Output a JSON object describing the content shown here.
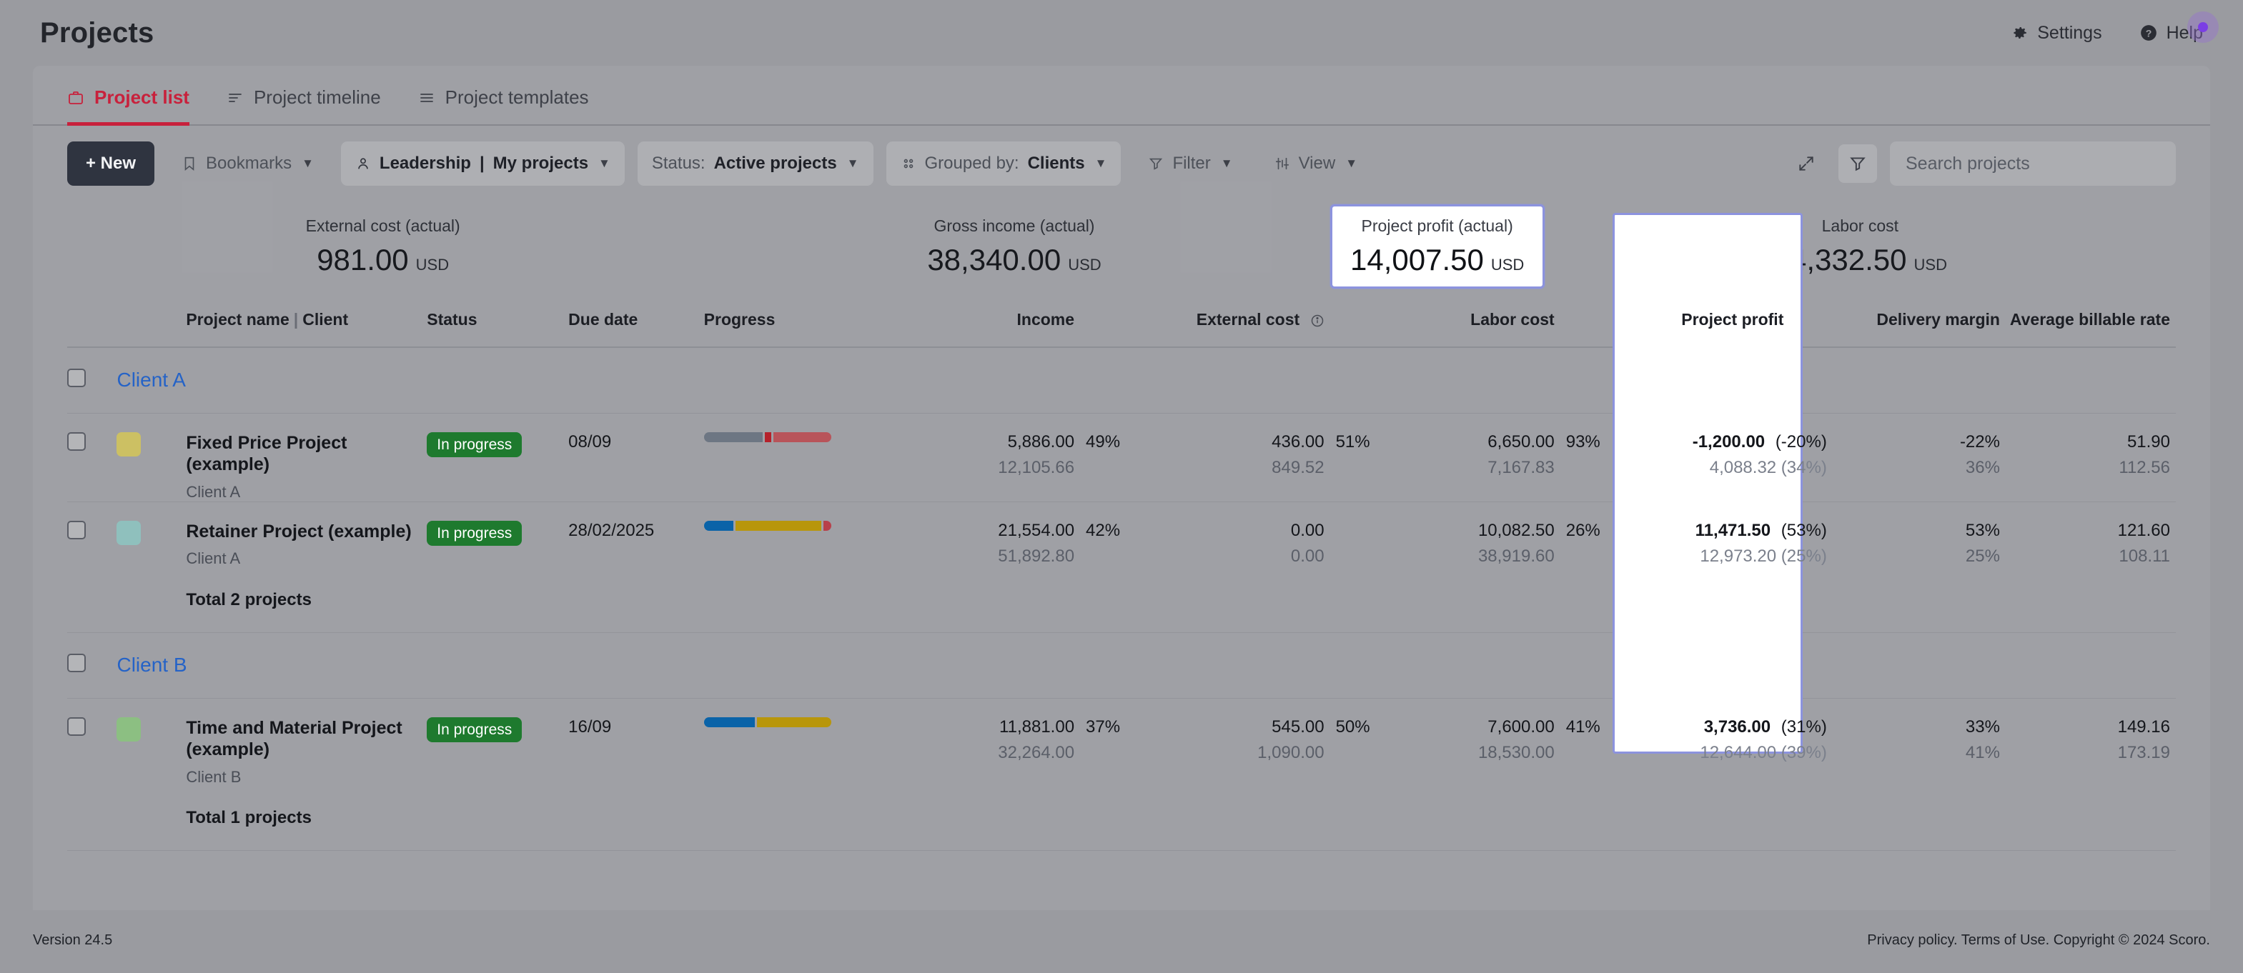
{
  "header": {
    "title": "Projects",
    "settings_label": "Settings",
    "help_label": "Help"
  },
  "tabs": [
    {
      "label": "Project list",
      "icon": "briefcase-icon",
      "active": true
    },
    {
      "label": "Project timeline",
      "icon": "timeline-icon",
      "active": false
    },
    {
      "label": "Project templates",
      "icon": "list-icon",
      "active": false
    }
  ],
  "toolbar": {
    "new_label": "+ New",
    "bookmarks_label": "Bookmarks",
    "view_scope_prefix": "Leadership",
    "view_scope_value": "My projects",
    "status_prefix": "Status:",
    "status_value": "Active projects",
    "grouped_prefix": "Grouped by:",
    "grouped_value": "Clients",
    "filter_label": "Filter",
    "view_label": "View",
    "search_placeholder": "Search projects"
  },
  "kpis": [
    {
      "label": "External cost (actual)",
      "value": "981.00",
      "currency": "USD",
      "highlight": false
    },
    {
      "label": "Gross income (actual)",
      "value": "38,340.00",
      "currency": "USD",
      "highlight": false
    },
    {
      "label": "Project profit (actual)",
      "value": "14,007.50",
      "currency": "USD",
      "highlight": true
    },
    {
      "label": "Labor cost",
      "value": "24,332.50",
      "currency": "USD",
      "highlight": false
    }
  ],
  "table": {
    "headers": {
      "project_name": "Project name",
      "client": "Client",
      "status": "Status",
      "due_date": "Due date",
      "progress": "Progress",
      "income": "Income",
      "external_cost": "External cost",
      "external_cost_info": "info-icon",
      "labor_cost": "Labor cost",
      "project_profit": "Project profit",
      "delivery_margin": "Delivery margin",
      "average_billable_rate": "Average billable rate"
    },
    "groups": [
      {
        "name": "Client A",
        "total_label": "Total 2 projects",
        "rows": [
          {
            "swatch_color": "#ccc063",
            "name": "Fixed Price Project (example)",
            "client": "Client A",
            "status": "In progress",
            "due_date": "08/09",
            "progress": [
              {
                "color": "#6d7683",
                "width": 48
              },
              {
                "color": "#b5212b",
                "width": 5
              },
              {
                "color": "#b8545a",
                "width": 47
              }
            ],
            "income": "5,886.00",
            "income_sub": "12,105.66",
            "income_pct": "49%",
            "external_cost": "436.00",
            "external_cost_sub": "849.52",
            "external_cost_pct": "51%",
            "labor_cost": "6,650.00",
            "labor_cost_sub": "7,167.83",
            "labor_cost_pct": "93%",
            "project_profit": "-1,200.00",
            "project_profit_pct": "(-20%)",
            "project_profit_sub": "4,088.32 (34%)",
            "delivery_margin": "-22%",
            "delivery_margin_sub": "36%",
            "avg_billable_rate": "51.90",
            "avg_billable_rate_sub": "112.56"
          },
          {
            "swatch_color": "#8fc0bd",
            "name": "Retainer Project (example)",
            "client": "Client A",
            "status": "In progress",
            "due_date": "28/02/2025",
            "progress": [
              {
                "color": "#0a63a8",
                "width": 24
              },
              {
                "color": "#b8960b",
                "width": 70
              },
              {
                "color": "#b8404a",
                "width": 6
              }
            ],
            "income": "21,554.00",
            "income_sub": "51,892.80",
            "income_pct": "42%",
            "external_cost": "0.00",
            "external_cost_sub": "0.00",
            "external_cost_pct": "",
            "labor_cost": "10,082.50",
            "labor_cost_sub": "38,919.60",
            "labor_cost_pct": "26%",
            "project_profit": "11,471.50",
            "project_profit_pct": "(53%)",
            "project_profit_sub": "12,973.20 (25%)",
            "delivery_margin": "53%",
            "delivery_margin_sub": "25%",
            "avg_billable_rate": "121.60",
            "avg_billable_rate_sub": "108.11"
          }
        ]
      },
      {
        "name": "Client B",
        "total_label": "Total 1 projects",
        "rows": [
          {
            "swatch_color": "#8cbf82",
            "name": "Time and Material Project (example)",
            "client": "Client B",
            "status": "In progress",
            "due_date": "16/09",
            "progress": [
              {
                "color": "#0a63a8",
                "width": 41
              },
              {
                "color": "#b8960b",
                "width": 59
              }
            ],
            "income": "11,881.00",
            "income_sub": "32,264.00",
            "income_pct": "37%",
            "external_cost": "545.00",
            "external_cost_sub": "1,090.00",
            "external_cost_pct": "50%",
            "labor_cost": "7,600.00",
            "labor_cost_sub": "18,530.00",
            "labor_cost_pct": "41%",
            "project_profit": "3,736.00",
            "project_profit_pct": "(31%)",
            "project_profit_sub": "12,644.00 (39%)",
            "delivery_margin": "33%",
            "delivery_margin_sub": "41%",
            "avg_billable_rate": "149.16",
            "avg_billable_rate_sub": "173.19"
          }
        ]
      }
    ]
  },
  "footer": {
    "version": "Version 24.5",
    "legal": "Privacy policy. Terms of Use. Copyright © 2024 Scoro."
  },
  "colors": {
    "accent_red": "#c8213c",
    "highlight_border": "#8c93de",
    "status_green": "#1e7a2e",
    "link_blue": "#2563c7",
    "cursor_purple": "#7b3fe4"
  }
}
